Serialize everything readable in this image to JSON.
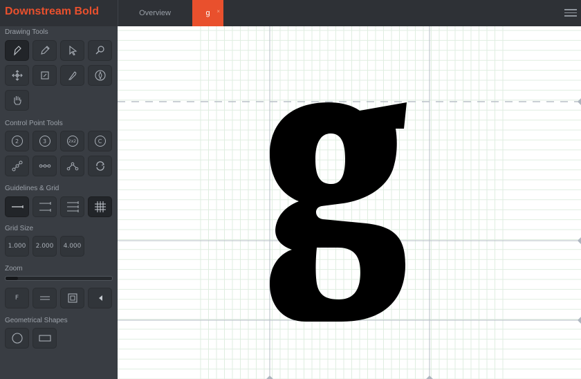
{
  "app": {
    "title": "Downstream Bold"
  },
  "tabs": [
    {
      "label": "Overview"
    },
    {
      "label": "g",
      "close": "×"
    }
  ],
  "sidebar": {
    "drawing_tools_label": "Drawing Tools",
    "control_point_tools_label": "Control Point Tools",
    "guidelines_label": "Guidelines & Grid",
    "grid_size_label": "Grid Size",
    "zoom_label": "Zoom",
    "shapes_label": "Geometrical Shapes",
    "control_tools": [
      "2",
      "3",
      "2x2",
      "C"
    ],
    "grid_sizes": [
      "1.000",
      "2.000",
      "4.000"
    ],
    "view_tools": [
      "F"
    ],
    "zoom_level": 0.12
  },
  "canvas": {
    "glyph": "g"
  },
  "colors": {
    "accent": "#e9502d",
    "sidebar_bg": "#393d43",
    "header_bg": "#2e3136",
    "grid_minor": "#dfeee0",
    "guide": "#b4bcc6"
  }
}
